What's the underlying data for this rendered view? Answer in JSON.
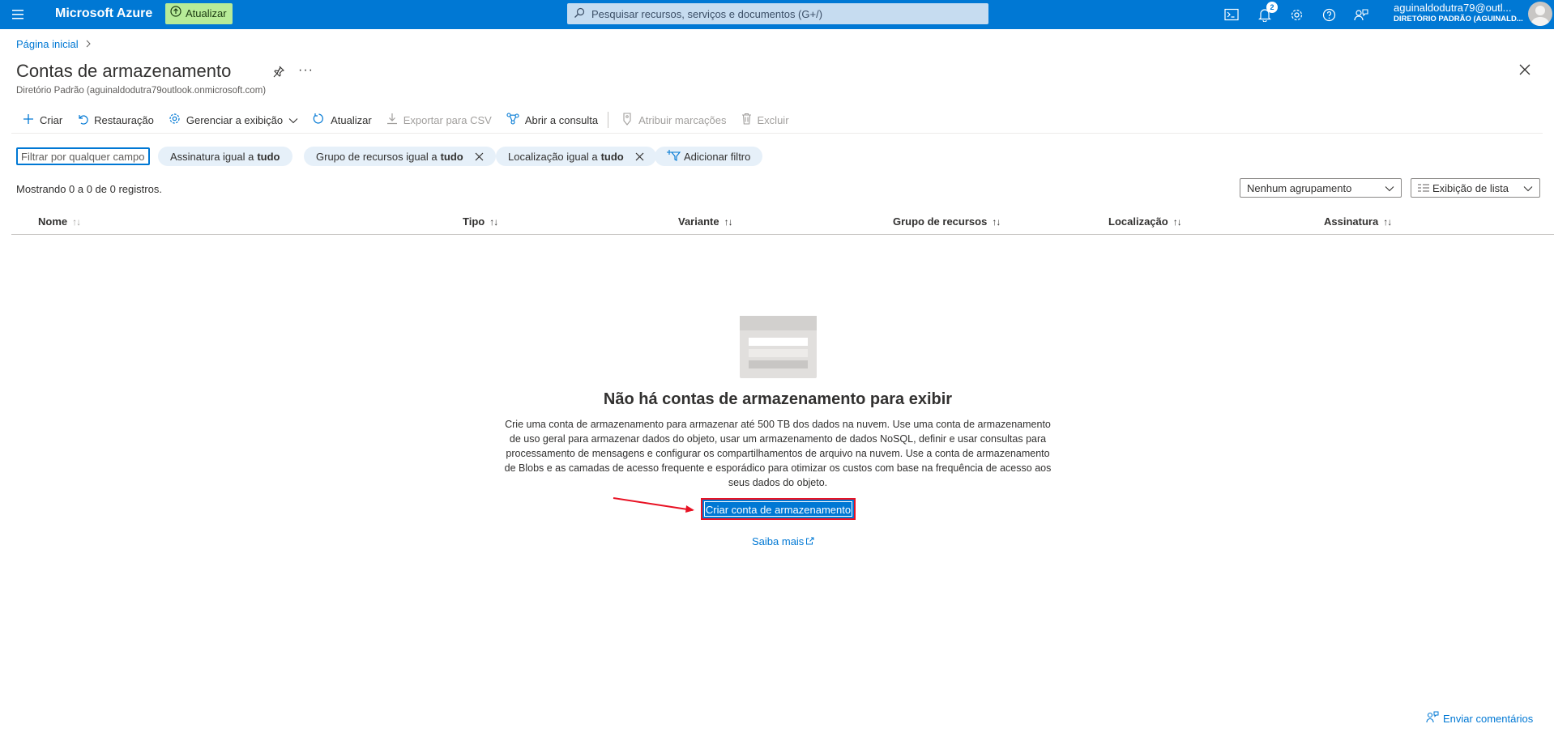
{
  "topbar": {
    "brand": "Microsoft Azure",
    "upgrade_label": "Atualizar",
    "search_placeholder": "Pesquisar recursos, serviços e documentos (G+/)",
    "notifications_count": "2",
    "account_name": "aguinaldodutra79@outl...",
    "account_directory": "DIRETÓRIO PADRÃO (AGUINALD...",
    "icons": [
      "menu-icon",
      "cloud-shell-icon",
      "bell-icon",
      "gear-icon",
      "help-icon",
      "feedback-icon"
    ]
  },
  "breadcrumb": {
    "home": "Página inicial",
    "separator": ">"
  },
  "page": {
    "title": "Contas de armazenamento",
    "subtitle": "Diretório Padrão (aguinaldodutra79outlook.onmicrosoft.com)"
  },
  "commands": [
    {
      "label": "Criar",
      "icon": "plus-icon",
      "enabled": true
    },
    {
      "label": "Restauração",
      "icon": "restore-icon",
      "enabled": true
    },
    {
      "label": "Gerenciar a exibição",
      "icon": "gear-icon",
      "enabled": true
    },
    {
      "label": "Atualizar",
      "icon": "refresh-icon",
      "enabled": true
    },
    {
      "label": "Exportar para CSV",
      "icon": "download-icon",
      "enabled": false
    },
    {
      "label": "Abrir a consulta",
      "icon": "query-icon",
      "enabled": true
    },
    {
      "label": "Atribuir marcações",
      "icon": "tag-icon",
      "enabled": false
    },
    {
      "label": "Excluir",
      "icon": "trash-icon",
      "enabled": false
    }
  ],
  "filters": {
    "input_placeholder": "Filtrar por qualquer campo...",
    "pills": [
      {
        "prefix": "Assinatura igual a ",
        "value": "tudo",
        "removable": false
      },
      {
        "prefix": "Grupo de recursos igual a ",
        "value": "tudo",
        "removable": true
      },
      {
        "prefix": "Localização igual a ",
        "value": "tudo",
        "removable": true
      }
    ],
    "add_filter": "Adicionar filtro"
  },
  "records_text": "Mostrando 0 a 0 de 0 registros.",
  "grouping_select": "Nenhum agrupamento",
  "view_select": "Exibição de lista",
  "table": {
    "columns": [
      "Nome",
      "Tipo",
      "Variante",
      "Grupo de recursos",
      "Localização",
      "Assinatura"
    ]
  },
  "empty_state": {
    "title": "Não há contas de armazenamento para exibir",
    "description": "Crie uma conta de armazenamento para armazenar até 500 TB dos dados na nuvem. Use uma conta de armazenamento de uso geral para armazenar dados do objeto, usar um armazenamento de dados NoSQL, definir e usar consultas para processamento de mensagens e configurar os compartilhamentos de arquivo na nuvem. Use a conta de armazenamento de Blobs e as camadas de acesso frequente e esporádico para otimizar os custos com base na frequência de acesso aos seus dados do objeto.",
    "create_button": "Criar conta de armazenamento",
    "learn_more": "Saiba mais"
  },
  "feedback_link": "Enviar comentários",
  "colors": {
    "azure_blue": "#0078d4",
    "upgrade_green": "#b7eb98",
    "highlight_red": "#e81123"
  }
}
